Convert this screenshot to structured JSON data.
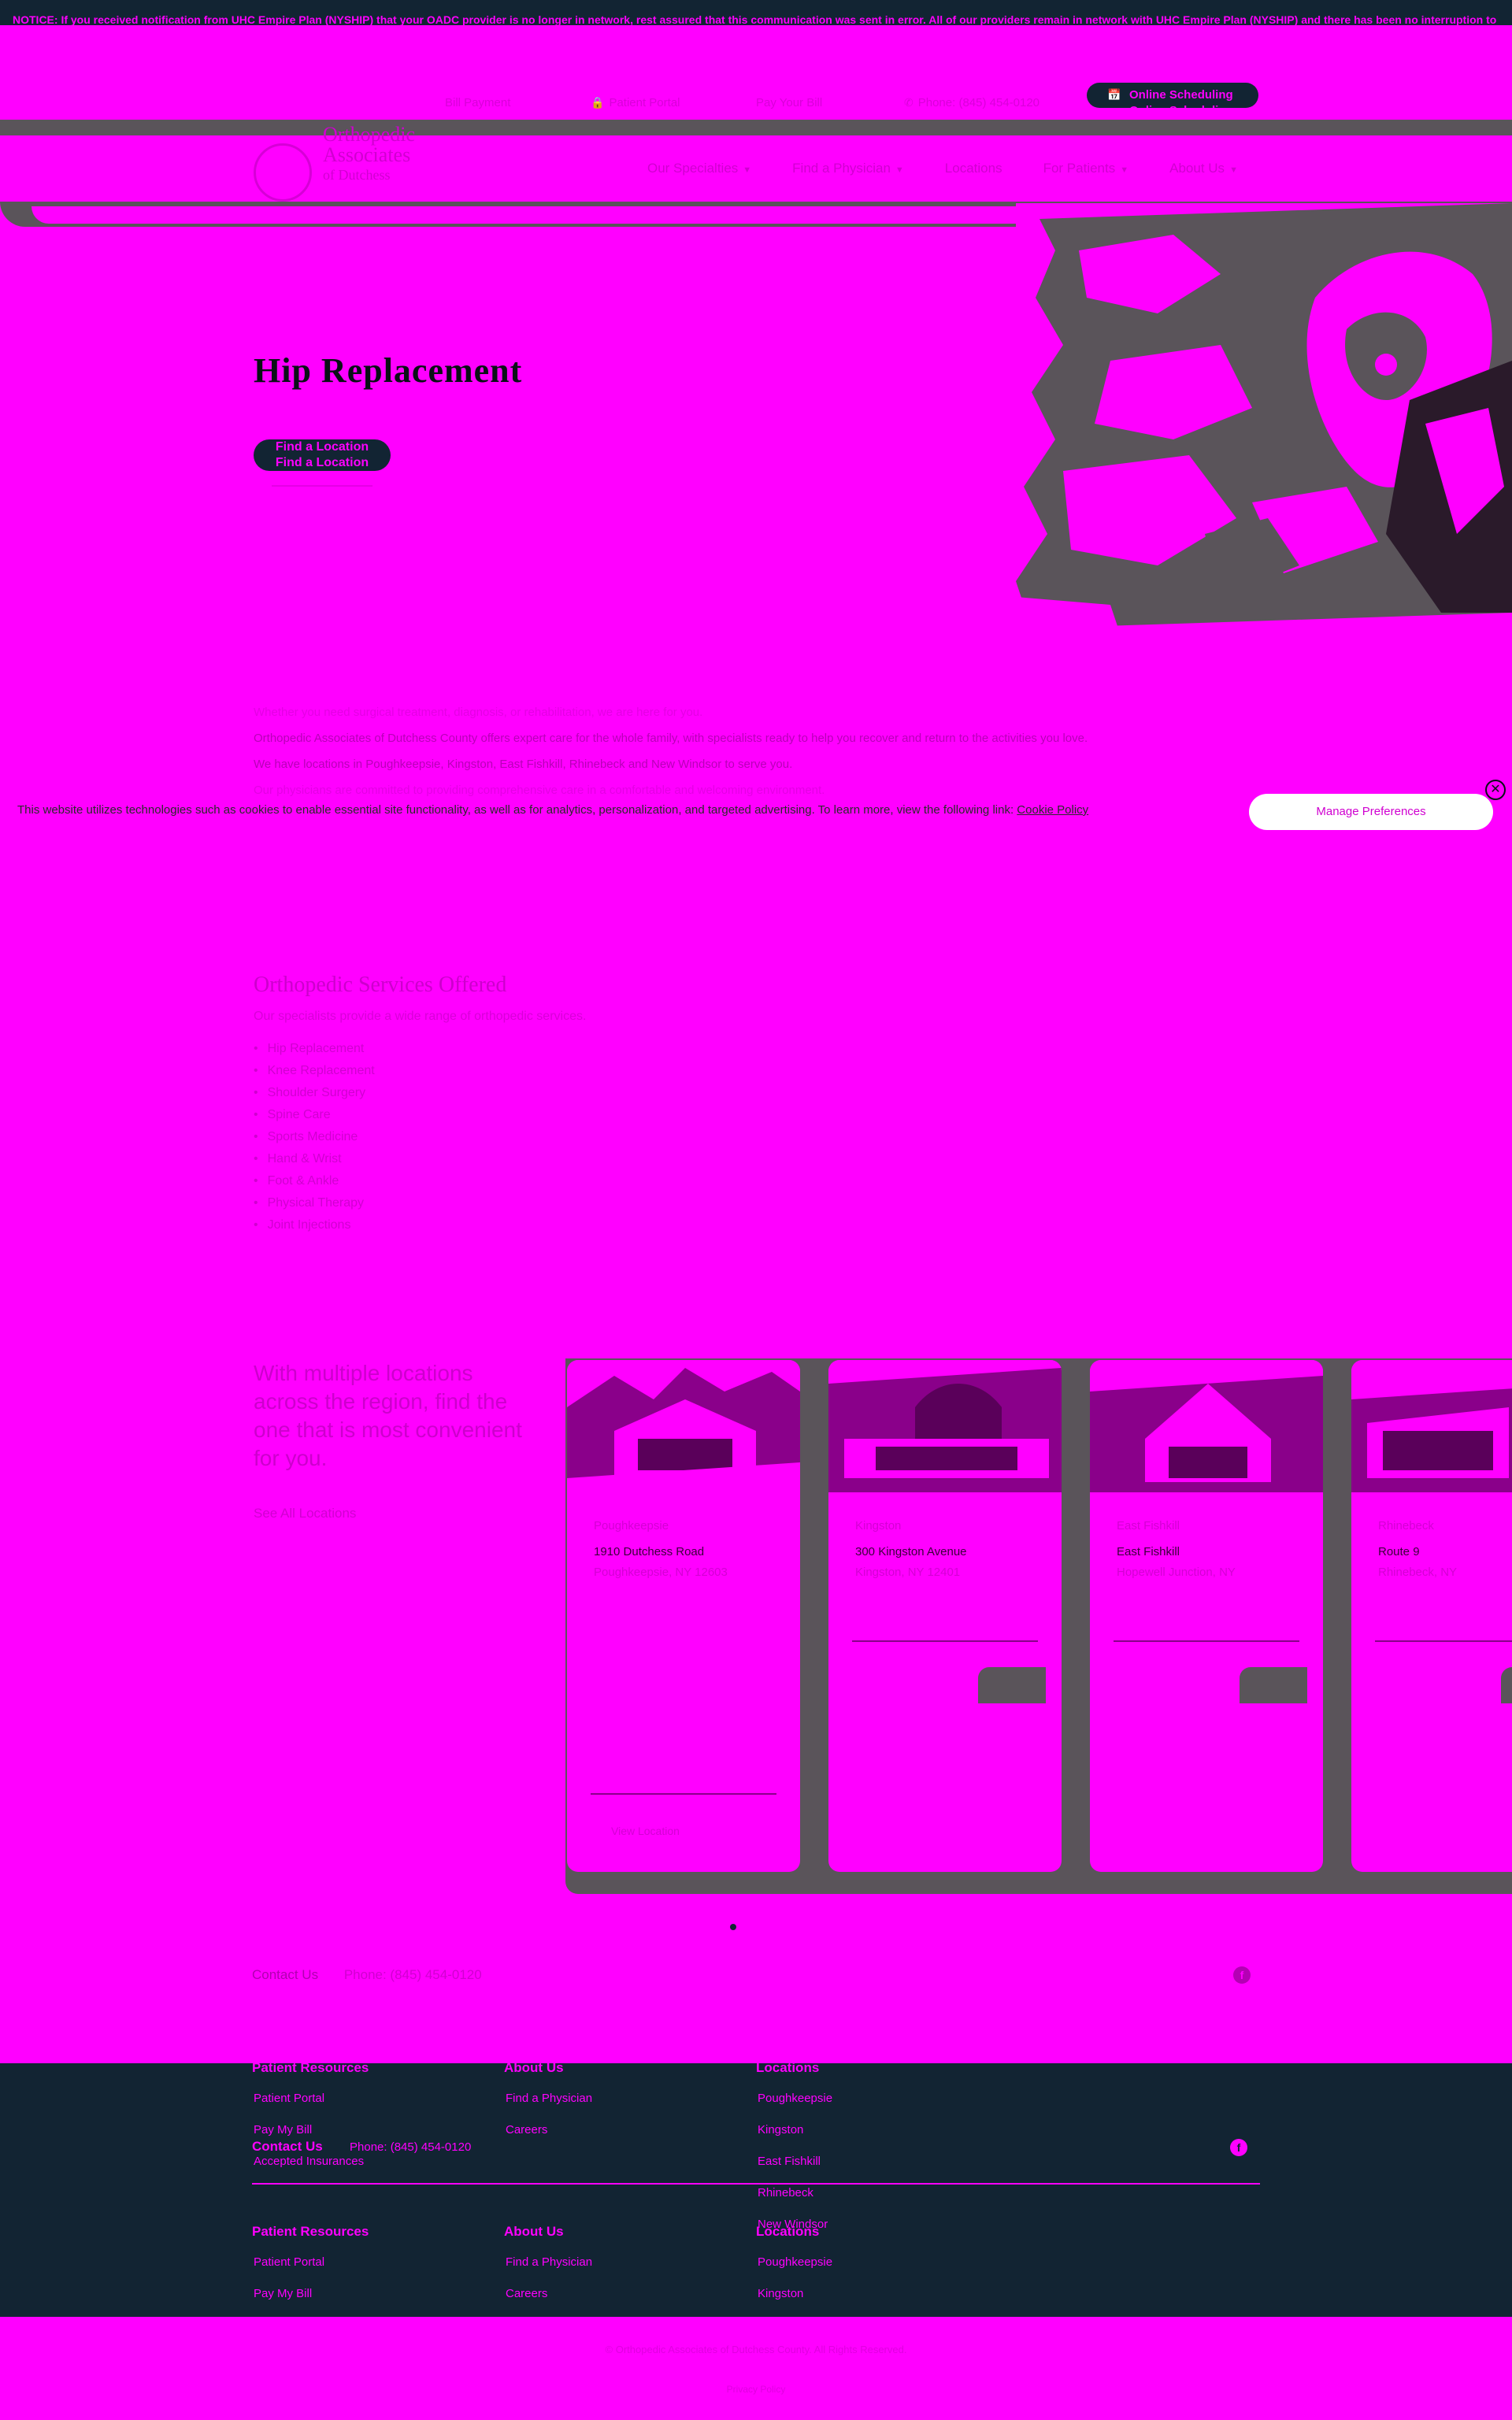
{
  "notice": "NOTICE: If you received notification from UHC Empire Plan (NYSHIP) that your OADC provider is no longer in network, rest assured that this communication was sent in error. All of our providers remain in network with UHC Empire Plan (NYSHIP) and there has been no interruption to",
  "utility": {
    "links": [
      {
        "label": "Bill Payment"
      },
      {
        "label": "Patient Portal"
      },
      {
        "label": "Pay Your Bill"
      },
      {
        "label": "Phone: (845) 454-0120"
      }
    ],
    "scheduling_label": "Online Scheduling"
  },
  "logo": {
    "line1": "Orthopedic",
    "line2": "Associates",
    "line3": "of Dutchess"
  },
  "nav": [
    {
      "label": "Our Specialties"
    },
    {
      "label": "Find a Physician"
    },
    {
      "label": "Locations"
    },
    {
      "label": "For Patients"
    },
    {
      "label": "About Us"
    }
  ],
  "hero": {
    "title": "Hip Replacement",
    "button_label": "Find a Location"
  },
  "intro": {
    "p1": "Whether you need surgical treatment, diagnosis, or rehabilitation, we are here for you.",
    "p2": "Orthopedic Associates of Dutchess County offers expert care for the whole family, with specialists ready to help you recover and return to the activities you love.",
    "p3": "We have locations in Poughkeepsie, Kingston, East Fishkill, Rhinebeck and New Windsor to serve you.",
    "p4": "Our physicians are committed to providing comprehensive care in a comfortable and welcoming environment."
  },
  "cookie": {
    "text": "This website utilizes technologies such as cookies to enable essential site functionality, as well as for analytics, personalization, and targeted advertising. To learn more, view the following link:",
    "link_label": "Cookie Policy",
    "manage_label": "Manage Preferences",
    "close_glyph": "✕"
  },
  "services": {
    "heading": "Orthopedic Services Offered",
    "subheading": "Our specialists provide a wide range of orthopedic services.",
    "items": [
      "Hip Replacement",
      "Knee Replacement",
      "Shoulder Surgery",
      "Spine Care",
      "Sports Medicine",
      "Hand & Wrist",
      "Foot & Ankle",
      "Physical Therapy",
      "Joint Injections"
    ]
  },
  "locations": {
    "heading": "With multiple locations across the region, find the one that is most convenient for you.",
    "all_label": "See All Locations",
    "cards": [
      {
        "name": "Poughkeepsie",
        "address": "1910 Dutchess Road",
        "city": "Poughkeepsie, NY 12603",
        "cta": "View Location"
      },
      {
        "name": "Kingston",
        "address": "300 Kingston Avenue",
        "city": "Kingston, NY 12401",
        "cta": ""
      },
      {
        "name": "East Fishkill",
        "address": "East Fishkill",
        "city": "Hopewell Junction, NY",
        "cta": ""
      },
      {
        "name": "Rhinebeck",
        "address": "Route 9",
        "city": "Rhinebeck, NY",
        "cta": ""
      }
    ]
  },
  "contact": {
    "label": "Contact Us",
    "phone": "Phone: (845) 454-0120",
    "fb_glyph": "f"
  },
  "footer": {
    "contact_label": "Contact Us",
    "phone": "Phone: (845) 454-0120",
    "cols": {
      "patient_resources": "Patient Resources",
      "about_us": "About Us",
      "locations": "Locations"
    },
    "patient_links": [
      "Patient Portal",
      "Pay My Bill",
      "Accepted Insurances"
    ],
    "about_links": [
      "Find a Physician",
      "Careers"
    ],
    "location_links": [
      "Poughkeepsie",
      "Kingston",
      "East Fishkill",
      "Rhinebeck",
      "New Windsor"
    ]
  },
  "copyright": "© Orthopedic Associates of Dutchess County. All Rights Reserved.",
  "legal": "Privacy Policy"
}
